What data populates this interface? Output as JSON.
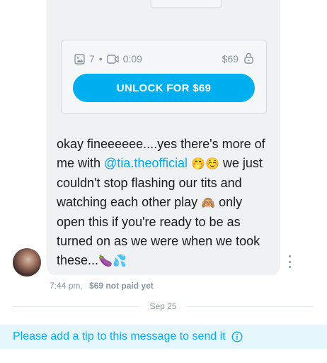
{
  "locked_post": {
    "photo_count": "7",
    "video_duration": "0:09",
    "price": "$69",
    "unlock_label": "UNLOCK FOR $69"
  },
  "message": {
    "text_before": "okay fineeeeee....yes there's more of me with ",
    "mention": "@tia.theofficial",
    "text_after_mention_emoji": " we just couldn't stop flashing our tits and watching each other play ",
    "text_after_monkey": " only open this if you're ready to be as turned on as we were when we took these...",
    "emoji_1": "🤭",
    "emoji_2": "☺️",
    "emoji_3": "🙈",
    "emoji_4": "🍆",
    "emoji_5": "💦"
  },
  "meta": {
    "time": "7:44 pm,",
    "status": "$69 not paid yet"
  },
  "date_separator": "Sep 25",
  "tip_prompt": "Please add a tip to this message to send it",
  "icons": [
    "image-icon",
    "video-icon",
    "lock-icon",
    "more-vertical-icon",
    "info-icon"
  ],
  "colors": {
    "accent": "#00aff0",
    "muted": "#8a96a3",
    "bubble": "#eff1f3",
    "tip_bar": "#e6f6fd"
  }
}
